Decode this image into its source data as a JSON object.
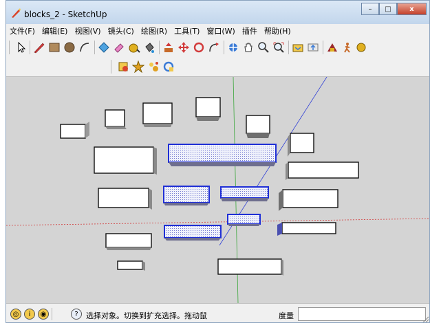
{
  "window": {
    "title": "blocks_2 - SketchUp"
  },
  "menu": [
    "文件(F)",
    "编辑(E)",
    "视图(V)",
    "镜头(C)",
    "绘图(R)",
    "工具(T)",
    "窗口(W)",
    "插件",
    "帮助(H)"
  ],
  "window_buttons": {
    "minimize": "–",
    "maximize": "□",
    "close": "x"
  },
  "toolbar": {
    "tools": [
      {
        "name": "select",
        "icon": "arrow-cursor-icon"
      },
      {
        "name": "line",
        "icon": "pencil-icon"
      },
      {
        "name": "rectangle",
        "icon": "rectangle-icon"
      },
      {
        "name": "circle",
        "icon": "circle-icon"
      },
      {
        "name": "arc",
        "icon": "arc-icon"
      },
      {
        "name": "make-component",
        "icon": "component-icon"
      },
      {
        "name": "eraser",
        "icon": "eraser-icon"
      },
      {
        "name": "tape-measure",
        "icon": "tape-measure-icon"
      },
      {
        "name": "paint-bucket",
        "icon": "paint-bucket-icon"
      },
      {
        "name": "push-pull",
        "icon": "push-pull-icon"
      },
      {
        "name": "move",
        "icon": "move-icon"
      },
      {
        "name": "rotate",
        "icon": "rotate-icon"
      },
      {
        "name": "follow-me",
        "icon": "follow-me-icon"
      },
      {
        "name": "orbit",
        "icon": "orbit-icon"
      },
      {
        "name": "pan",
        "icon": "hand-icon"
      },
      {
        "name": "zoom",
        "icon": "magnifier-icon"
      },
      {
        "name": "zoom-extents",
        "icon": "zoom-extents-icon"
      },
      {
        "name": "get-models",
        "icon": "get-models-icon"
      },
      {
        "name": "share-model",
        "icon": "share-model-icon"
      },
      {
        "name": "component-warehouse",
        "icon": "warehouse-icon"
      },
      {
        "name": "walk",
        "icon": "walk-icon"
      },
      {
        "name": "extra",
        "icon": "extra-icon"
      }
    ],
    "secondary_tools": [
      {
        "name": "plugin-1",
        "icon": "plugin-box-icon"
      },
      {
        "name": "plugin-2",
        "icon": "plugin-burst-icon"
      },
      {
        "name": "plugin-3",
        "icon": "plugin-sparkle-icon"
      },
      {
        "name": "plugin-4",
        "icon": "plugin-refresh-icon"
      }
    ]
  },
  "status": {
    "hint": "选择对象。切换到扩充选择。拖动鼠",
    "measure_label": "度量",
    "measure_value": ""
  },
  "colors": {
    "viewport_bg": "#d4d4d4",
    "selection_blue": "#1f2fd6",
    "axis_red": "#d23b3b",
    "axis_green": "#3aa63a",
    "axis_blue": "#2f3fd6"
  }
}
